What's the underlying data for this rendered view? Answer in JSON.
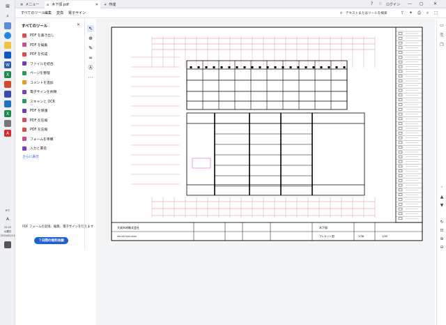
{
  "titlebar": {
    "menu_label": "メニュー",
    "doc_tab": "木下邸.pdf",
    "new_tab": "作成",
    "login": "ログイン"
  },
  "menubar": {
    "items": [
      "すべてのツール",
      "編集",
      "変換",
      "電子サイン"
    ],
    "search": "テキストまたはツールを検索"
  },
  "tools_panel": {
    "title": "すべてのツール",
    "items": [
      {
        "label": "PDF を書き出し",
        "color": "#e34850"
      },
      {
        "label": "PDF を編集",
        "color": "#d04a8c"
      },
      {
        "label": "PDF を作成",
        "color": "#e34850"
      },
      {
        "label": "ファイルを結合",
        "color": "#6b3fc4"
      },
      {
        "label": "ページを整理",
        "color": "#2c9b5a"
      },
      {
        "label": "コメントを追加",
        "color": "#e0a21c"
      },
      {
        "label": "電子サインを依頼",
        "color": "#7a3fc4"
      },
      {
        "label": "スキャンと OCR",
        "color": "#2c9b5a"
      },
      {
        "label": "PDF を保護",
        "color": "#6b3fc4"
      },
      {
        "label": "PDF を圧縮",
        "color": "#e34850"
      },
      {
        "label": "PDF を圧縮",
        "color": "#e34850"
      },
      {
        "label": "フォームを準備",
        "color": "#d04a8c"
      },
      {
        "label": "入力と署名",
        "color": "#7a3fc4"
      }
    ],
    "more": "さらに表示",
    "promo": "PDF フォームの変換、編集、電子サインを行えます",
    "trial_button": "７日間の無料体験"
  },
  "taskbar": {
    "temp": "6℃",
    "ime": "A",
    "time": "22:22",
    "day": "火曜日",
    "date": "2024/02/13"
  },
  "drawing": {
    "title_block": {
      "company": "大成木材株式会社",
      "phone": "TEL 097-555-0000",
      "project": "木下邸",
      "drawing_name": "プレカット図",
      "page": "1/38",
      "scale": "1/50"
    }
  },
  "colors": {
    "accent": "#1d5fd6",
    "red_lines": "#e06070"
  }
}
